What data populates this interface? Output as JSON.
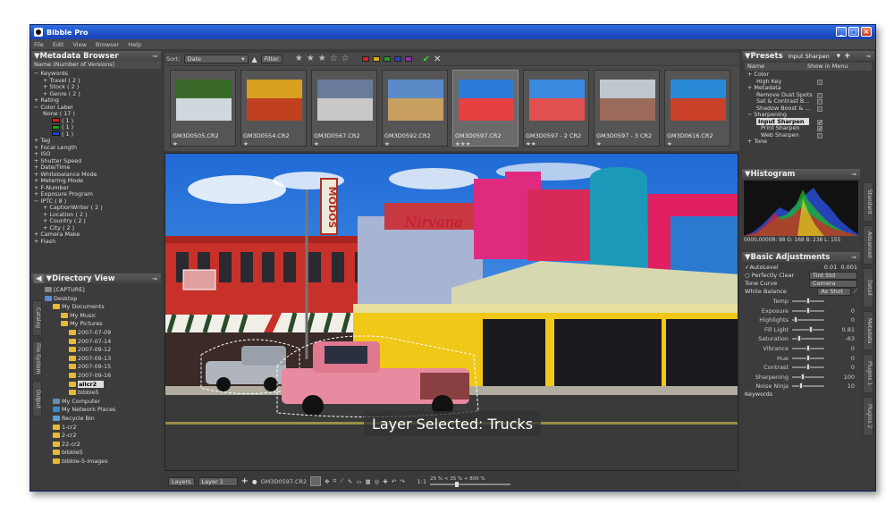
{
  "app": {
    "title": "Bibble Pro",
    "menu": [
      "File",
      "Edit",
      "View",
      "Browser",
      "Help"
    ]
  },
  "metadata_browser": {
    "title": "Metadata Browser",
    "column": "Name (Number of Versions)",
    "items": [
      {
        "text": "−  Keywords",
        "indent": 0
      },
      {
        "text": "+  Travel ( 2 )",
        "indent": 2
      },
      {
        "text": "+  Stock ( 2 )",
        "indent": 2
      },
      {
        "text": "+  Genre ( 2 )",
        "indent": 2
      },
      {
        "text": "+  Rating",
        "indent": 0
      },
      {
        "text": "−  Color Label",
        "indent": 0
      },
      {
        "text": "None ( 17 )",
        "indent": 2
      },
      {
        "text": "( 1 )",
        "indent": 4,
        "swatch": "#d42020"
      },
      {
        "text": "( 1 )",
        "indent": 4,
        "swatch": "#20a020"
      },
      {
        "text": "( 1 )",
        "indent": 4,
        "swatch": "#2040d0"
      },
      {
        "text": "+  Tag",
        "indent": 0
      },
      {
        "text": "+  Focal Length",
        "indent": 0
      },
      {
        "text": "+  ISO",
        "indent": 0
      },
      {
        "text": "+  Shutter Speed",
        "indent": 0
      },
      {
        "text": "+  Date/Time",
        "indent": 0
      },
      {
        "text": "+  Whitebalance Mode",
        "indent": 0
      },
      {
        "text": "+  Metering Mode",
        "indent": 0
      },
      {
        "text": "+  F-Number",
        "indent": 0
      },
      {
        "text": "+  Exposure Program",
        "indent": 0
      },
      {
        "text": "−  IPTC ( 8 )",
        "indent": 0
      },
      {
        "text": "+  CaptionWriter ( 2 )",
        "indent": 2
      },
      {
        "text": "+  Location ( 2 )",
        "indent": 2
      },
      {
        "text": "+  Country ( 2 )",
        "indent": 2
      },
      {
        "text": "+  City ( 2 )",
        "indent": 2
      },
      {
        "text": "+  Camera Make",
        "indent": 0
      },
      {
        "text": "+  Flash",
        "indent": 0
      }
    ]
  },
  "directory_view": {
    "title": "Directory View",
    "items": [
      {
        "text": "[CAPTURE]",
        "indent": 0,
        "icon": "gear"
      },
      {
        "text": "Desktop",
        "indent": 0,
        "icon": "desktop"
      },
      {
        "text": "My Documents",
        "indent": 1
      },
      {
        "text": "My Music",
        "indent": 2
      },
      {
        "text": "My Pictures",
        "indent": 2
      },
      {
        "text": "2007-07-09",
        "indent": 3
      },
      {
        "text": "2007-07-14",
        "indent": 3
      },
      {
        "text": "2007-09-12",
        "indent": 3
      },
      {
        "text": "2007-09-13",
        "indent": 3
      },
      {
        "text": "2007-09-15",
        "indent": 3
      },
      {
        "text": "2007-09-16",
        "indent": 3
      },
      {
        "text": "allcr2",
        "indent": 3,
        "selected": true
      },
      {
        "text": "bibble5",
        "indent": 3
      },
      {
        "text": "My Computer",
        "indent": 1,
        "icon": "computer"
      },
      {
        "text": "My Network Places",
        "indent": 1,
        "icon": "network"
      },
      {
        "text": "Recycle Bin",
        "indent": 1,
        "icon": "recycle"
      },
      {
        "text": "1-cr2",
        "indent": 1
      },
      {
        "text": "2-cr2",
        "indent": 1
      },
      {
        "text": "22-cr2",
        "indent": 1
      },
      {
        "text": "bibble5",
        "indent": 1
      },
      {
        "text": "bibble-5-images",
        "indent": 1
      }
    ],
    "side_tabs": [
      "Catalog",
      "File System",
      "Output"
    ]
  },
  "toolbar": {
    "sort_label": "Sort:",
    "sort_value": "Date",
    "filter_label": "Filter"
  },
  "filmstrip": [
    {
      "name": "GM3D0505.CR2",
      "stars": "★",
      "colors": [
        "#3a6a2a",
        "#cfd8dc"
      ]
    },
    {
      "name": "GM3D0554.CR2",
      "stars": "★",
      "colors": [
        "#d8a020",
        "#c04020"
      ]
    },
    {
      "name": "GM3D0567.CR2",
      "stars": "★",
      "colors": [
        "#6a7a9a",
        "#c8c8c8"
      ]
    },
    {
      "name": "GM3D0592.CR2",
      "stars": "★",
      "colors": [
        "#5a8ac8",
        "#c8a060"
      ]
    },
    {
      "name": "GM3D0597.CR2",
      "stars": "★★★",
      "colors": [
        "#2a7ad8",
        "#e84040"
      ],
      "active": true
    },
    {
      "name": "GM3D0597 - 2 CR2",
      "stars": "★★",
      "colors": [
        "#3a8ae0",
        "#e05050"
      ]
    },
    {
      "name": "GM3D0597 - 3 CR2",
      "stars": "★",
      "colors": [
        "#bfc7cf",
        "#9a6a5a"
      ]
    },
    {
      "name": "GM3D0616.CR2",
      "stars": "★",
      "colors": [
        "#2a8ad8",
        "#c84028"
      ]
    }
  ],
  "viewer": {
    "overlay": "Layer Selected: Trucks",
    "sign_left": "MODOS",
    "sign_mid": "Nirvana"
  },
  "statusbar": {
    "layers_label": "Layers",
    "layer_value": "Layer 1",
    "file": "GM3D0597.CR2",
    "zoom": "1:1",
    "zoom_scale": "25 %  <  35 %  <  800 %"
  },
  "presets": {
    "title": "Presets",
    "selected": "Input Sharpen",
    "col_name": "Name",
    "col_show": "Show in Menu",
    "items": [
      {
        "text": "+  Color",
        "indent": 0
      },
      {
        "text": "High Key",
        "indent": 2
      },
      {
        "text": "+  Metadata",
        "indent": 0
      },
      {
        "text": "Remove Dust Spots",
        "indent": 2
      },
      {
        "text": "Sat & Contrast B...",
        "indent": 2
      },
      {
        "text": "Shadow Boost & ...",
        "indent": 2
      },
      {
        "text": "−  Sharpening",
        "indent": 0
      },
      {
        "text": "Input Sharpen",
        "indent": 2,
        "selected": true
      },
      {
        "text": "Print Sharpen",
        "indent": 3
      },
      {
        "text": "Web Sharpen",
        "indent": 3
      },
      {
        "text": "+  Tone",
        "indent": 0
      }
    ]
  },
  "histogram": {
    "title": "Histogram",
    "readout": "0000,0000R: 98 G: 168 B: 238 L: 155"
  },
  "basic": {
    "title": "Basic Adjustments",
    "autolevel": "AutoLevel",
    "autolevel_v1": "0.01",
    "autolevel_v2": "0.001",
    "perfectly_clear": "Perfectly Clear",
    "pc_value": "Tint Std",
    "tone_curve": "Tone Curve",
    "tone_value": "Camera",
    "white_balance": "White Balance",
    "wb_value": "As Shot",
    "sliders": [
      {
        "name": "Temp",
        "value": "",
        "pos": 0.5
      },
      {
        "name": "Exposure",
        "value": "0",
        "pos": 0.5
      },
      {
        "name": "Highlights",
        "value": "0",
        "pos": 0.05
      },
      {
        "name": "Fill Light",
        "value": "0.81",
        "pos": 0.6
      },
      {
        "name": "Saturation",
        "value": "-63",
        "pos": 0.2
      },
      {
        "name": "Vibrance",
        "value": "0",
        "pos": 0.5
      },
      {
        "name": "Hue",
        "value": "0",
        "pos": 0.5
      },
      {
        "name": "Contrast",
        "value": "0",
        "pos": 0.5
      },
      {
        "name": "Sharpening",
        "value": "100",
        "pos": 0.3
      },
      {
        "name": "Noise Ninja",
        "value": "10",
        "pos": 0.25
      }
    ],
    "keywords": "Keywords"
  },
  "right_tabs": [
    "Standard",
    "Advanced",
    "Detail",
    "Metadata",
    "Plugins 1",
    "Plugins 2"
  ]
}
